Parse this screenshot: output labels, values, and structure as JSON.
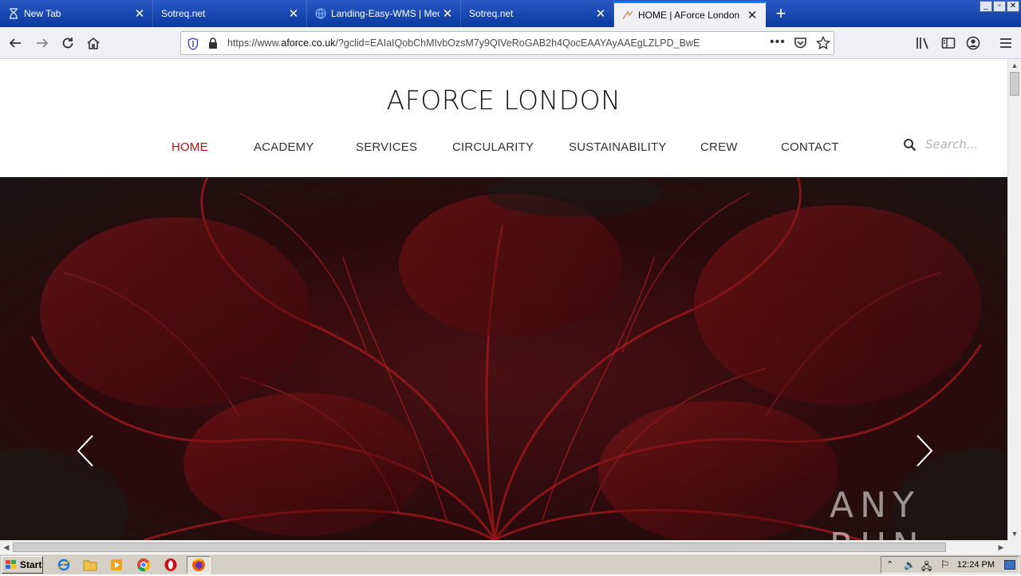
{
  "tabs": [
    {
      "title": "New Tab",
      "icon": "hourglass-icon",
      "active": false
    },
    {
      "title": "Sotreq.net",
      "icon": "",
      "active": false
    },
    {
      "title": "Landing-Easy-WMS | Mecal",
      "icon": "globe-icon",
      "active": false
    },
    {
      "title": "Sotreq.net",
      "icon": "",
      "active": false
    },
    {
      "title": "HOME | AForce London",
      "icon": "site-favicon-icon",
      "active": true
    }
  ],
  "address_bar": {
    "url_prefix": "https://www.",
    "url_domain": "aforce.co.uk",
    "url_rest": "/?gclid=EAIaIQobChMIvbOzsM7y9QIVeRoGAB2h4QocEAAYAyAAEgLZLPD_BwE"
  },
  "site": {
    "logo": "AFORCE LONDON",
    "nav": [
      {
        "label": "HOME",
        "current": true
      },
      {
        "label": "ACADEMY",
        "current": false
      },
      {
        "label": "SERVICES",
        "current": false
      },
      {
        "label": "CIRCULARITY",
        "current": false
      },
      {
        "label": "SUSTAINABILITY",
        "current": false
      },
      {
        "label": "CREW",
        "current": false
      },
      {
        "label": "CONTACT",
        "current": false
      }
    ],
    "search_placeholder": "Search..."
  },
  "watermark": "ANY RUN",
  "taskbar": {
    "start_label": "Start",
    "clock": "12:24 PM"
  },
  "colors": {
    "accent_red": "#b5120f",
    "tab_strip": "#0a3aa0",
    "active_tab_top": "#0a84ff"
  }
}
